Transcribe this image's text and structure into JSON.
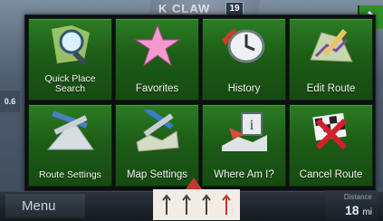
{
  "map": {
    "street_name": "K CLAW",
    "street_badge": "19",
    "left_tab": "0.6"
  },
  "menu": {
    "tiles": [
      {
        "label": "Quick Place Search",
        "icon": "magnifier-icon"
      },
      {
        "label": "Favorites",
        "icon": "star-icon"
      },
      {
        "label": "History",
        "icon": "clock-history-icon"
      },
      {
        "label": "Edit Route",
        "icon": "edit-route-icon"
      },
      {
        "label": "Route Settings",
        "icon": "route-settings-icon"
      },
      {
        "label": "Map Settings",
        "icon": "map-settings-icon"
      },
      {
        "label": "Where Am I?",
        "icon": "where-am-i-icon"
      },
      {
        "label": "Cancel Route",
        "icon": "cancel-route-icon"
      }
    ]
  },
  "bottom_bar": {
    "menu_label": "Menu",
    "distance_caption": "Distance",
    "distance_value": "18",
    "distance_unit": "mi"
  },
  "colors": {
    "tile_green": "#1d5d17",
    "accent_green": "#2f8f2a",
    "panel_bg": "#0b0f12"
  }
}
